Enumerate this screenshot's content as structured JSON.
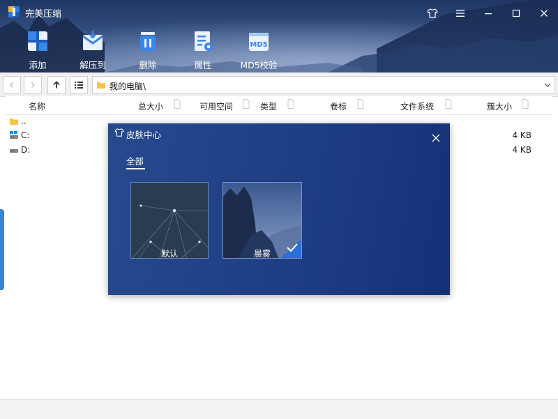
{
  "app": {
    "title": "完美压缩"
  },
  "toolbar": {
    "items": [
      {
        "id": "add",
        "label": "添加",
        "icon": "add-files-icon"
      },
      {
        "id": "extract",
        "label": "解压到",
        "icon": "extract-to-icon"
      },
      {
        "id": "delete",
        "label": "删除",
        "icon": "delete-icon"
      },
      {
        "id": "properties",
        "label": "属性",
        "icon": "properties-icon"
      },
      {
        "id": "md5",
        "label": "MD5校验",
        "icon": "md5-check-icon"
      }
    ]
  },
  "address": {
    "path": "我的电脑\\"
  },
  "columns": [
    "名称",
    "总大小",
    "可用空间",
    "类型",
    "卷标",
    "文件系统",
    "簇大小"
  ],
  "rows": [
    {
      "name": "..",
      "icon": "folder-icon",
      "cluster_size": ""
    },
    {
      "name": "C:",
      "icon": "system-drive-icon",
      "cluster_size": "4 KB"
    },
    {
      "name": "D:",
      "icon": "drive-icon",
      "cluster_size": "4 KB"
    }
  ],
  "skin_dialog": {
    "title": "皮肤中心",
    "tab": "全部",
    "skins": [
      {
        "name": "默认",
        "selected": false
      },
      {
        "name": "晨雾",
        "selected": true
      }
    ]
  },
  "colors": {
    "accent": "#2b7be0",
    "dialog_bg": "#1f3f85"
  }
}
